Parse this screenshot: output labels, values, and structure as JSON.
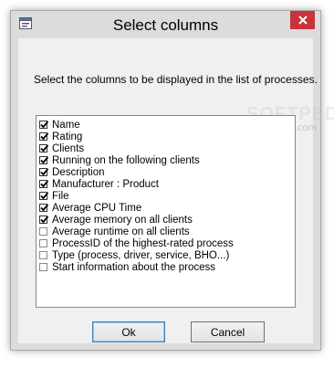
{
  "dialog": {
    "title": "Select columns",
    "instruction": "Select the columns to be displayed in the list of processes.",
    "watermark": "SOFTPEDIA",
    "watermark_url": "www.softpedia.com",
    "columns": [
      {
        "label": "Name",
        "checked": true
      },
      {
        "label": "Rating",
        "checked": true
      },
      {
        "label": "Clients",
        "checked": true
      },
      {
        "label": "Running on the following clients",
        "checked": true
      },
      {
        "label": "Description",
        "checked": true
      },
      {
        "label": "Manufacturer : Product",
        "checked": true
      },
      {
        "label": "File",
        "checked": true
      },
      {
        "label": "Average CPU Time",
        "checked": true
      },
      {
        "label": "Average memory on all clients",
        "checked": true
      },
      {
        "label": "Average runtime on all clients",
        "checked": false
      },
      {
        "label": "ProcessID of the highest-rated process",
        "checked": false
      },
      {
        "label": "Type (process, driver, service, BHO...)",
        "checked": false
      },
      {
        "label": "Start information about the process",
        "checked": false
      }
    ],
    "ok_label": "Ok",
    "cancel_label": "Cancel",
    "close_icon": "close-icon",
    "app_icon": "window-app-icon",
    "close_color": "#c7343b"
  }
}
